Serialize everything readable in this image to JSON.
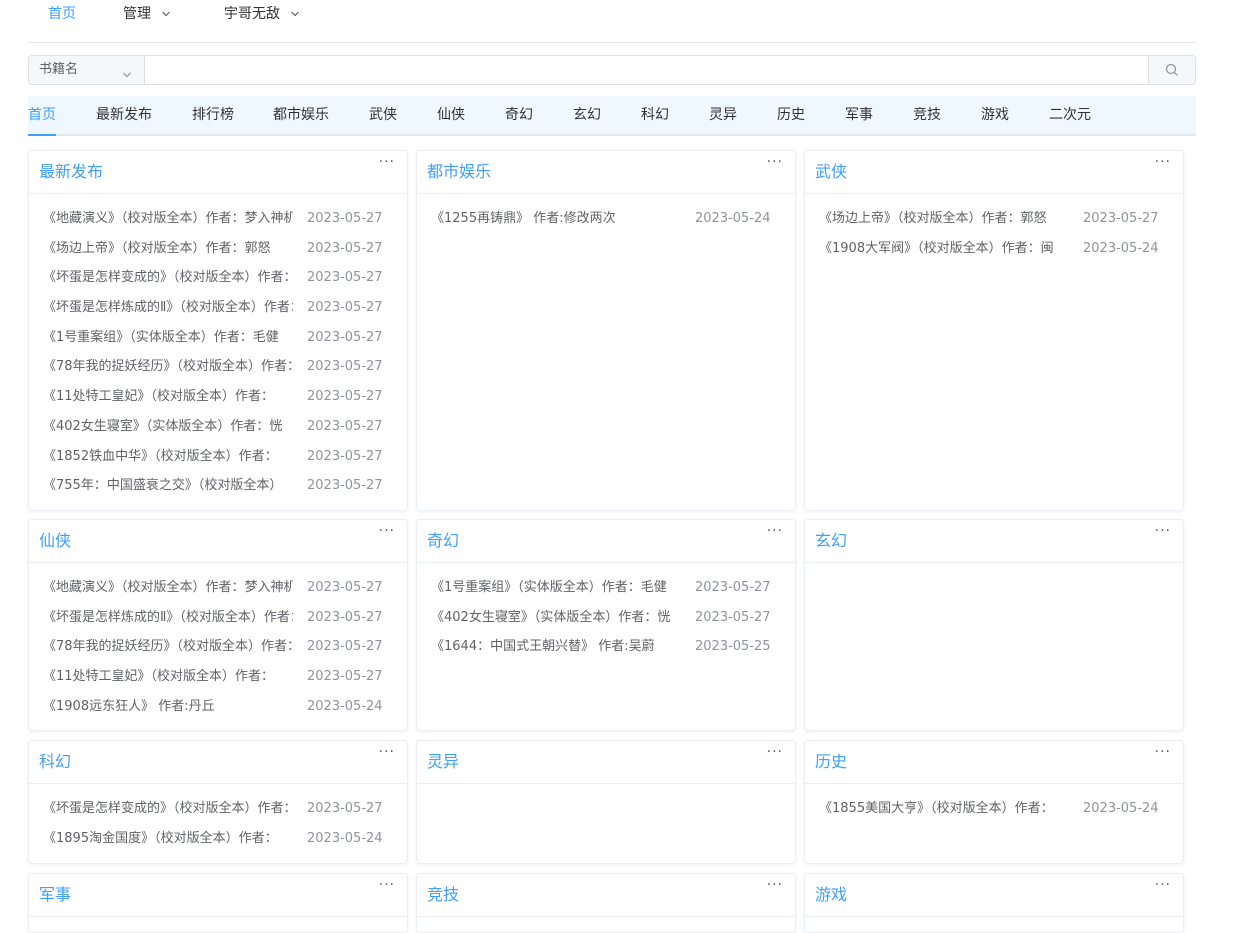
{
  "nav": {
    "items": [
      {
        "label": "首页",
        "active": true,
        "dropdown": false
      },
      {
        "label": "管理",
        "active": false,
        "dropdown": true
      },
      {
        "label": "宇哥无敌",
        "active": false,
        "dropdown": true
      }
    ]
  },
  "search": {
    "select_value": "书籍名",
    "placeholder": "",
    "value": "",
    "button_icon": "search-icon"
  },
  "tabs": [
    "首页",
    "最新发布",
    "排行榜",
    "都市娱乐",
    "武侠",
    "仙侠",
    "奇幻",
    "玄幻",
    "科幻",
    "灵异",
    "历史",
    "军事",
    "竞技",
    "游戏",
    "二次元"
  ],
  "active_tab": 0,
  "accent_color": "#409eff",
  "more_label": "···",
  "cards": [
    {
      "title": "最新发布",
      "rows": [
        {
          "name": "《地藏演义》（校对版全本）作者：梦入神机",
          "date": "2023-05-27"
        },
        {
          "name": "《场边上帝》（校对版全本）作者：郭怒",
          "date": "2023-05-27"
        },
        {
          "name": "《坏蛋是怎样变成的》（校对版全本）作者：六道",
          "date": "2023-05-27"
        },
        {
          "name": "《坏蛋是怎样炼成的Ⅱ》（校对版全本）作者：六道",
          "date": "2023-05-27"
        },
        {
          "name": "《1号重案组》（实体版全本）作者：毛健",
          "date": "2023-05-27"
        },
        {
          "name": "《78年我的捉妖经历》（校对版全本）作者：",
          "date": "2023-05-27"
        },
        {
          "name": "《11处特工皇妃》（校对版全本）作者：",
          "date": "2023-05-27"
        },
        {
          "name": "《402女生寝室》（实体版全本）作者：恍",
          "date": "2023-05-27"
        },
        {
          "name": "《1852铁血中华》（校对版全本）作者：",
          "date": "2023-05-27"
        },
        {
          "name": "《755年：中国盛衰之交》（校对版全本）",
          "date": "2023-05-27"
        }
      ]
    },
    {
      "title": "都市娱乐",
      "rows": [
        {
          "name": "《1255再铸鼎》 作者:修改两次",
          "date": "2023-05-24"
        }
      ]
    },
    {
      "title": "武侠",
      "rows": [
        {
          "name": "《场边上帝》（校对版全本）作者：郭怒",
          "date": "2023-05-27"
        },
        {
          "name": "《1908大军阀》（校对版全本）作者：闽",
          "date": "2023-05-24"
        }
      ]
    },
    {
      "title": "仙侠",
      "rows": [
        {
          "name": "《地藏演义》（校对版全本）作者：梦入神机",
          "date": "2023-05-27"
        },
        {
          "name": "《坏蛋是怎样炼成的Ⅱ》（校对版全本）作者：六道",
          "date": "2023-05-27"
        },
        {
          "name": "《78年我的捉妖经历》（校对版全本）作者：",
          "date": "2023-05-27"
        },
        {
          "name": "《11处特工皇妃》（校对版全本）作者：",
          "date": "2023-05-27"
        },
        {
          "name": "《1908远东狂人》 作者:丹丘",
          "date": "2023-05-24"
        }
      ]
    },
    {
      "title": "奇幻",
      "rows": [
        {
          "name": "《1号重案组》（实体版全本）作者：毛健",
          "date": "2023-05-27"
        },
        {
          "name": "《402女生寝室》（实体版全本）作者：恍",
          "date": "2023-05-27"
        },
        {
          "name": "《1644：中国式王朝兴替》 作者:吴蔚",
          "date": "2023-05-25"
        }
      ]
    },
    {
      "title": "玄幻",
      "rows": []
    },
    {
      "title": "科幻",
      "rows": [
        {
          "name": "《坏蛋是怎样变成的》（校对版全本）作者：六道",
          "date": "2023-05-27"
        },
        {
          "name": "《1895淘金国度》（校对版全本）作者：",
          "date": "2023-05-24"
        }
      ]
    },
    {
      "title": "灵异",
      "rows": []
    },
    {
      "title": "历史",
      "rows": [
        {
          "name": "《1855美国大亨》（校对版全本）作者：",
          "date": "2023-05-24"
        }
      ]
    },
    {
      "title": "军事",
      "rows": []
    },
    {
      "title": "竞技",
      "rows": []
    },
    {
      "title": "游戏",
      "rows": []
    }
  ]
}
